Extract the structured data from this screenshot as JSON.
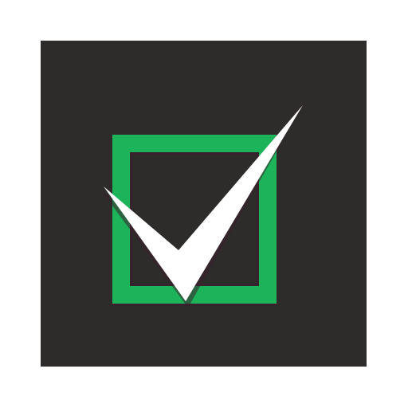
{
  "icon": {
    "name": "checked-checkbox-icon",
    "state": "checked",
    "colors": {
      "background": "#2d2c2a",
      "box_border": "#1db35a",
      "box_inner_shadow": "#3a1f2e",
      "checkmark": "#ffffff",
      "page": "#ffffff"
    }
  }
}
